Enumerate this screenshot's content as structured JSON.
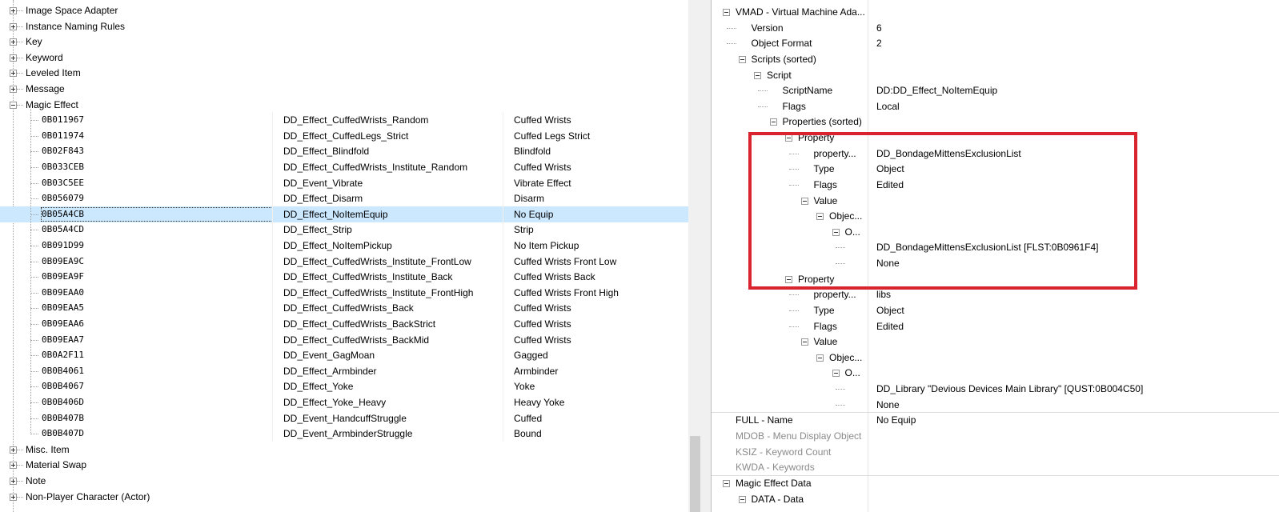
{
  "left_tree": {
    "categories_top": [
      {
        "label": "Image Space Adapter",
        "expanded": false
      },
      {
        "label": "Instance Naming Rules",
        "expanded": false
      },
      {
        "label": "Key",
        "expanded": false
      },
      {
        "label": "Keyword",
        "expanded": false
      },
      {
        "label": "Leveled Item",
        "expanded": false
      },
      {
        "label": "Message",
        "expanded": false
      },
      {
        "label": "Magic Effect",
        "expanded": true
      }
    ],
    "records": [
      {
        "formid": "0B011967",
        "editor_id": "DD_Effect_CuffedWrists_Random",
        "name": "Cuffed Wrists"
      },
      {
        "formid": "0B011974",
        "editor_id": "DD_Effect_CuffedLegs_Strict",
        "name": "Cuffed Legs Strict"
      },
      {
        "formid": "0B02F843",
        "editor_id": "DD_Effect_Blindfold",
        "name": "Blindfold"
      },
      {
        "formid": "0B033CEB",
        "editor_id": "DD_Effect_CuffedWrists_Institute_Random",
        "name": "Cuffed Wrists"
      },
      {
        "formid": "0B03C5EE",
        "editor_id": "DD_Event_Vibrate",
        "name": "Vibrate Effect"
      },
      {
        "formid": "0B056079",
        "editor_id": "DD_Effect_Disarm",
        "name": "Disarm"
      },
      {
        "formid": "0B05A4CB",
        "editor_id": "DD_Effect_NoItemEquip",
        "name": "No Equip",
        "selected": true
      },
      {
        "formid": "0B05A4CD",
        "editor_id": "DD_Effect_Strip",
        "name": "Strip"
      },
      {
        "formid": "0B091D99",
        "editor_id": "DD_Effect_NoItemPickup",
        "name": "No Item Pickup"
      },
      {
        "formid": "0B09EA9C",
        "editor_id": "DD_Effect_CuffedWrists_Institute_FrontLow",
        "name": "Cuffed Wrists Front Low"
      },
      {
        "formid": "0B09EA9F",
        "editor_id": "DD_Effect_CuffedWrists_Institute_Back",
        "name": "Cuffed Wrists Back"
      },
      {
        "formid": "0B09EAA0",
        "editor_id": "DD_Effect_CuffedWrists_Institute_FrontHigh",
        "name": "Cuffed Wrists Front High"
      },
      {
        "formid": "0B09EAA5",
        "editor_id": "DD_Effect_CuffedWrists_Back",
        "name": "Cuffed Wrists"
      },
      {
        "formid": "0B09EAA6",
        "editor_id": "DD_Effect_CuffedWrists_BackStrict",
        "name": "Cuffed Wrists"
      },
      {
        "formid": "0B09EAA7",
        "editor_id": "DD_Effect_CuffedWrists_BackMid",
        "name": "Cuffed Wrists"
      },
      {
        "formid": "0B0A2F11",
        "editor_id": "DD_Event_GagMoan",
        "name": "Gagged"
      },
      {
        "formid": "0B0B4061",
        "editor_id": "DD_Effect_Armbinder",
        "name": "Armbinder"
      },
      {
        "formid": "0B0B4067",
        "editor_id": "DD_Effect_Yoke",
        "name": "Yoke"
      },
      {
        "formid": "0B0B406D",
        "editor_id": "DD_Effect_Yoke_Heavy",
        "name": "Heavy Yoke"
      },
      {
        "formid": "0B0B407B",
        "editor_id": "DD_Event_HandcuffStruggle",
        "name": "Cuffed"
      },
      {
        "formid": "0B0B407D",
        "editor_id": "DD_Event_ArmbinderStruggle",
        "name": "Bound"
      }
    ],
    "categories_bottom": [
      {
        "label": "Misc. Item",
        "expanded": false
      },
      {
        "label": "Material Swap",
        "expanded": false
      },
      {
        "label": "Note",
        "expanded": false
      },
      {
        "label": "Non-Player Character (Actor)",
        "expanded": false
      }
    ]
  },
  "right_tree": {
    "rows": [
      {
        "label": "VMAD - Virtual Machine Ada...",
        "value": "",
        "expander": "minus",
        "gray": false
      },
      {
        "label": "Version",
        "value": "6",
        "expander": "",
        "gray": false
      },
      {
        "label": "Object Format",
        "value": "2",
        "expander": "",
        "gray": false
      },
      {
        "label": "Scripts (sorted)",
        "value": "",
        "expander": "minus",
        "gray": false
      },
      {
        "label": "Script",
        "value": "",
        "expander": "minus",
        "gray": false
      },
      {
        "label": "ScriptName",
        "value": "DD:DD_Effect_NoItemEquip",
        "expander": "",
        "gray": false
      },
      {
        "label": "Flags",
        "value": "Local",
        "expander": "",
        "gray": false
      },
      {
        "label": "Properties (sorted)",
        "value": "",
        "expander": "minus",
        "gray": false
      },
      {
        "label": "Property",
        "value": "",
        "expander": "minus",
        "gray": false
      },
      {
        "label": "property...",
        "value": "DD_BondageMittensExclusionList",
        "expander": "",
        "gray": false
      },
      {
        "label": "Type",
        "value": "Object",
        "expander": "",
        "gray": false
      },
      {
        "label": "Flags",
        "value": "Edited",
        "expander": "",
        "gray": false
      },
      {
        "label": "Value",
        "value": "",
        "expander": "minus",
        "gray": false
      },
      {
        "label": "Objec...",
        "value": "",
        "expander": "minus",
        "gray": false
      },
      {
        "label": "O...",
        "value": "",
        "expander": "minus",
        "gray": false
      },
      {
        "label": "",
        "value": "DD_BondageMittensExclusionList [FLST:0B0961F4]",
        "expander": "",
        "gray": false
      },
      {
        "label": "",
        "value": "None",
        "expander": "",
        "gray": false
      },
      {
        "label": "Property",
        "value": "",
        "expander": "minus",
        "gray": false
      },
      {
        "label": "property...",
        "value": "libs",
        "expander": "",
        "gray": false
      },
      {
        "label": "Type",
        "value": "Object",
        "expander": "",
        "gray": false
      },
      {
        "label": "Flags",
        "value": "Edited",
        "expander": "",
        "gray": false
      },
      {
        "label": "Value",
        "value": "",
        "expander": "minus",
        "gray": false
      },
      {
        "label": "Objec...",
        "value": "",
        "expander": "minus",
        "gray": false
      },
      {
        "label": "O...",
        "value": "",
        "expander": "minus",
        "gray": false
      },
      {
        "label": "",
        "value": "DD_Library \"Devious Devices Main Library\" [QUST:0B004C50]",
        "expander": "",
        "gray": false
      },
      {
        "label": "",
        "value": "None",
        "expander": "",
        "gray": false
      },
      {
        "label": "FULL - Name",
        "value": "No Equip",
        "expander": "",
        "gray": false
      },
      {
        "label": "MDOB - Menu Display Object",
        "value": "",
        "expander": "",
        "gray": true
      },
      {
        "label": "KSIZ - Keyword Count",
        "value": "",
        "expander": "",
        "gray": true
      },
      {
        "label": "KWDA - Keywords",
        "value": "",
        "expander": "",
        "gray": true
      },
      {
        "label": "Magic Effect Data",
        "value": "",
        "expander": "minus",
        "gray": false
      },
      {
        "label": "DATA - Data",
        "value": "",
        "expander": "minus",
        "gray": false
      }
    ]
  },
  "colors": {
    "selection": "#cce8ff",
    "highlight_box": "#d9232e",
    "disabled_text": "#8a8a8a"
  }
}
